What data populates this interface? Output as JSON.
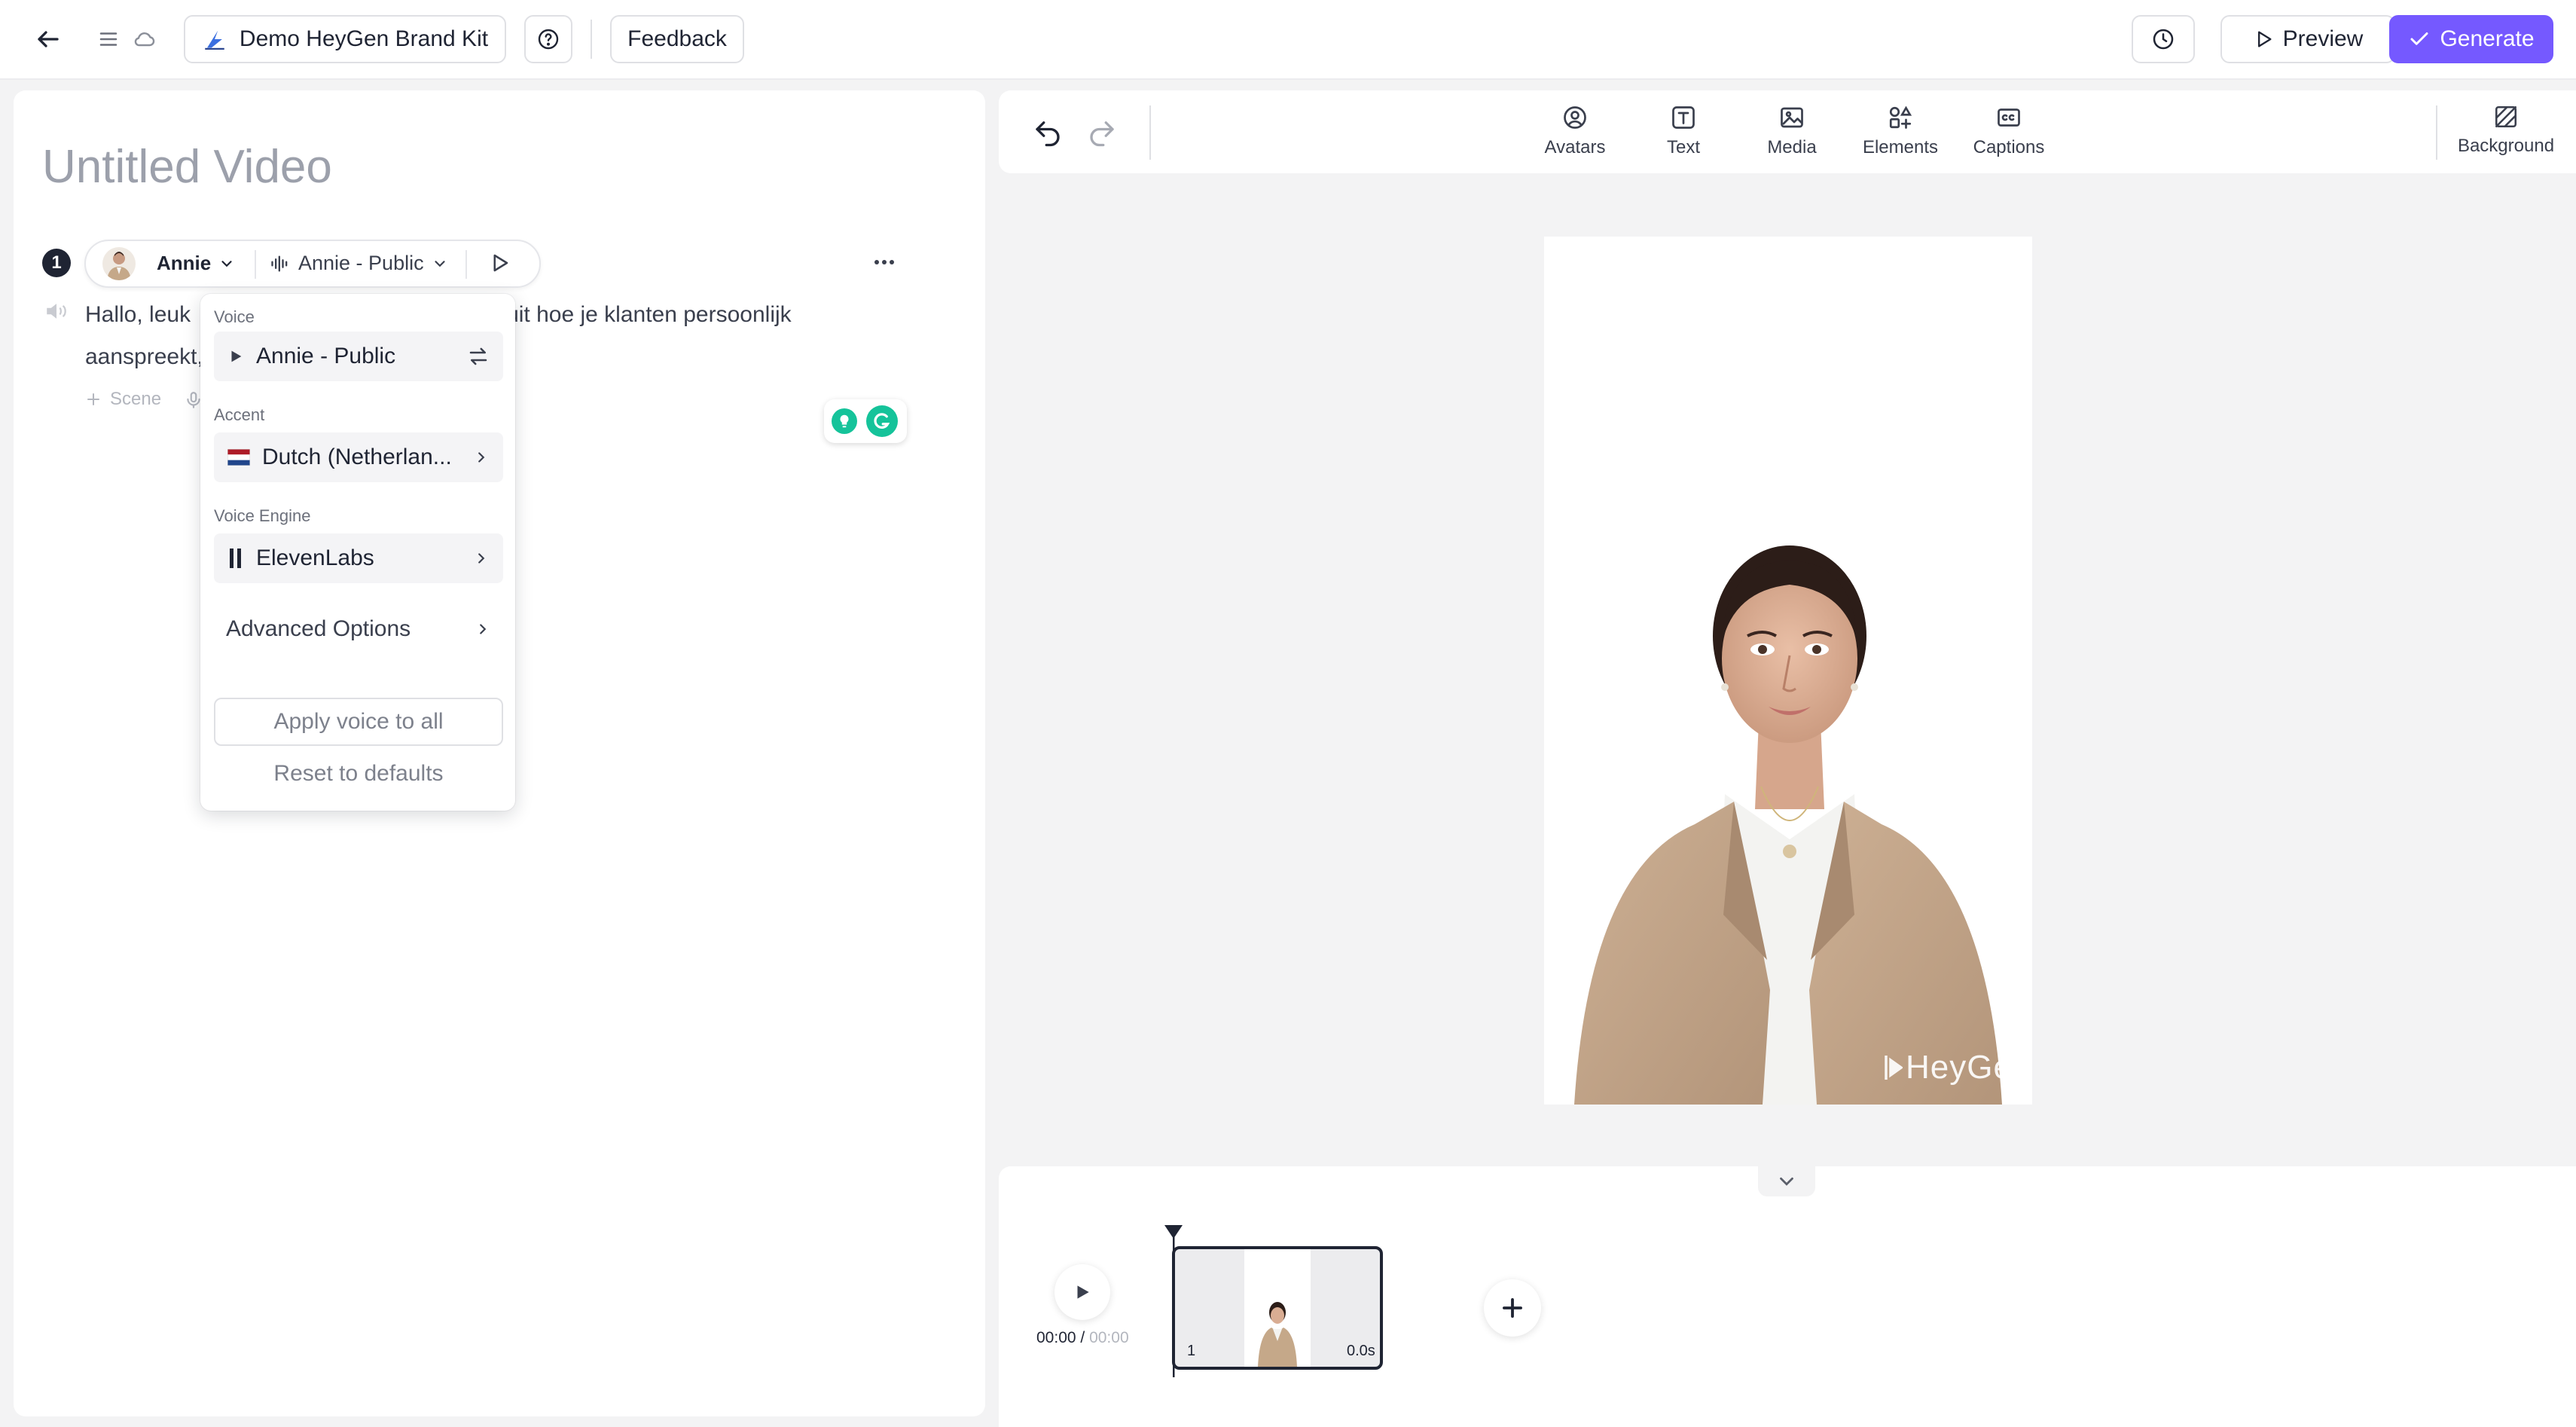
{
  "header": {
    "brand_kit_label": "Demo HeyGen Brand Kit",
    "feedback_label": "Feedback",
    "preview_label": "Preview",
    "generate_label": "Generate"
  },
  "editor": {
    "title_placeholder": "Untitled Video",
    "scene_number": "1",
    "avatar_name": "Annie",
    "voice_name": "Annie - Public",
    "script_line1": "Hallo, leuk ",
    "script_line1_tail": "t uit hoe je klanten persoonlijk",
    "script_line2": "aanspreekt,",
    "add_scene_label": "Scene"
  },
  "voice_menu": {
    "voice_label": "Voice",
    "voice_value": "Annie - Public",
    "accent_label": "Accent",
    "accent_value": "Dutch (Netherlan...",
    "engine_label": "Voice Engine",
    "engine_value": "ElevenLabs",
    "advanced_label": "Advanced Options",
    "apply_all_label": "Apply voice to all",
    "reset_label": "Reset to defaults"
  },
  "toolbar": {
    "tools": [
      "Avatars",
      "Text",
      "Media",
      "Elements",
      "Captions"
    ],
    "background_label": "Background"
  },
  "canvas": {
    "watermark": "HeyGen"
  },
  "timeline": {
    "time_current": "00:00",
    "time_separator": " / ",
    "time_total": "00:00",
    "clip_index": "1",
    "clip_duration": "0.0s"
  },
  "colors": {
    "accent": "#7559ff",
    "grammarly_green": "#15c39a",
    "text_dark": "#1f2433"
  }
}
